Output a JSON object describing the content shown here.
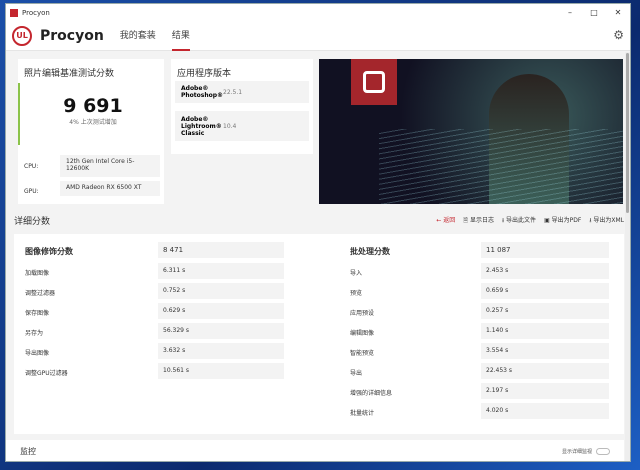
{
  "window": {
    "title": "Procyon",
    "min": "–",
    "max": "□",
    "close": "✕"
  },
  "header": {
    "logo": "UL",
    "brand": "Procyon",
    "tabs": [
      {
        "label": "我的套装"
      },
      {
        "label": "结果"
      }
    ],
    "gear": "⚙"
  },
  "score_card": {
    "title": "照片编辑基准测试分数",
    "score": "9 691",
    "sub": "4% 上次测试增加",
    "cpu_label": "CPU:",
    "cpu": "12th Gen Intel Core i5-12600K",
    "gpu_label": "GPU:",
    "gpu": "AMD Radeon RX 6500 XT"
  },
  "versions": {
    "title": "应用程序版本",
    "items": [
      {
        "app": "Adobe® Photoshop®",
        "version": "22.5.1"
      },
      {
        "app": "Adobe® Lightroom® Classic",
        "version": "10.4"
      }
    ]
  },
  "detail": {
    "title": "详细分数",
    "actions": {
      "back": "返回",
      "log": "显示日志",
      "export_file": "导出此文件",
      "export_pdf": "导出为PDF",
      "export_xml": "导出为XML"
    }
  },
  "left": {
    "title": "图像修饰分数",
    "score": "8 471",
    "rows": [
      {
        "label": "加载图像",
        "value": "6.311 s"
      },
      {
        "label": "调整过滤器",
        "value": "0.752 s"
      },
      {
        "label": "保存图像",
        "value": "0.629 s"
      },
      {
        "label": "另存为",
        "value": "56.329 s"
      },
      {
        "label": "导出图像",
        "value": "3.632 s"
      },
      {
        "label": "调整GPU过滤器",
        "value": "10.561 s"
      }
    ]
  },
  "right": {
    "title": "批处理分数",
    "score": "11 087",
    "rows": [
      {
        "label": "导入",
        "value": "2.453 s"
      },
      {
        "label": "预览",
        "value": "0.659 s"
      },
      {
        "label": "应用预设",
        "value": "0.257 s"
      },
      {
        "label": "编辑图像",
        "value": "1.140 s"
      },
      {
        "label": "智能预览",
        "value": "3.554 s"
      },
      {
        "label": "导出",
        "value": "22.453 s"
      },
      {
        "label": "增强的详细信息",
        "value": "2.197 s"
      },
      {
        "label": "批量统计",
        "value": "4.020 s"
      }
    ]
  },
  "monitor": {
    "title": "监控",
    "toggle_label": "显示详细监视"
  }
}
